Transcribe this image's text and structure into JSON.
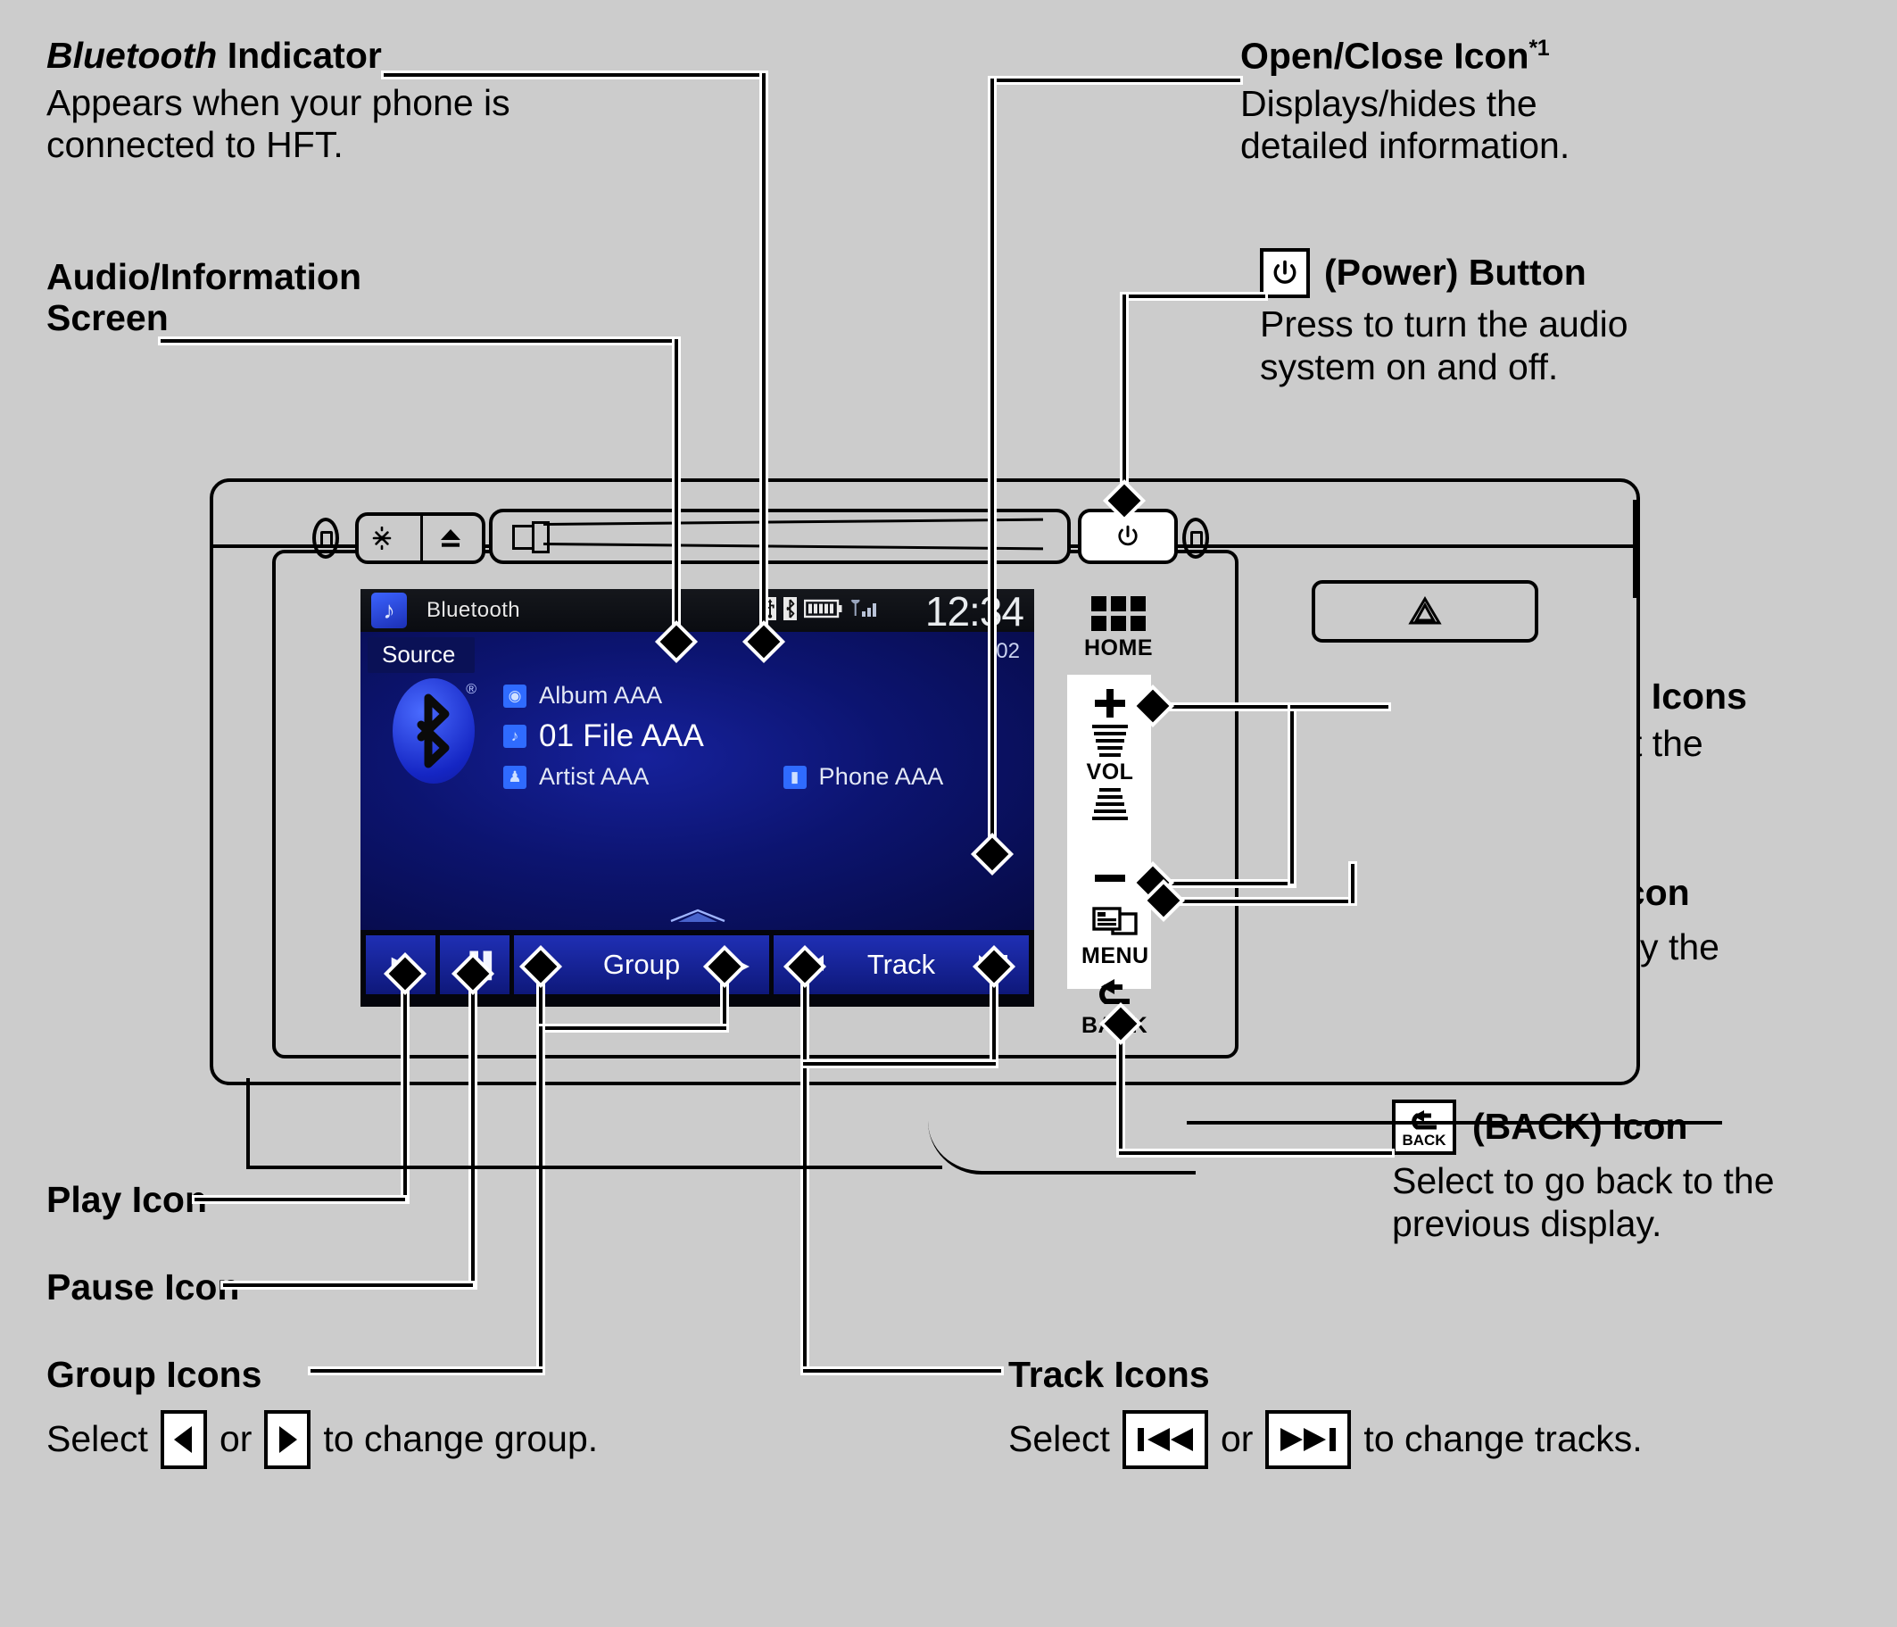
{
  "page": {
    "background_color": "#cccccc",
    "title": "Audio/Information Screen callout diagram"
  },
  "callouts": [
    {
      "id": "bluetooth-indicator",
      "title_italic": "Bluetooth",
      "title_rest": " Indicator",
      "body": "Appears when your phone is connected to HFT."
    },
    {
      "id": "audio-information-screen",
      "title": "Audio/Information Screen",
      "body": ""
    },
    {
      "id": "open-close-icon",
      "title": "Open/Close Icon",
      "superscript": "*1",
      "body": "Displays/hides the detailed information."
    },
    {
      "id": "power-button",
      "title": "(Power) Button",
      "icon": "power-icon",
      "body": "Press to turn the audio system on and off."
    },
    {
      "id": "volume-icons",
      "title": "VOL/ (Volume) Icons",
      "body": "Select to adjust the volume."
    },
    {
      "id": "menu-icon",
      "title": "(MENU) Icon",
      "icon": "menu-icon",
      "body": "Select to display the menu items."
    },
    {
      "id": "back-icon",
      "title": "(BACK) Icon",
      "icon": "back-icon",
      "body": "Select to go back to the previous display."
    },
    {
      "id": "play-icon",
      "title": "Play Icon",
      "body": ""
    },
    {
      "id": "pause-icon",
      "title": "Pause Icon",
      "body": ""
    },
    {
      "id": "group-icons",
      "title": "Group Icons",
      "prose_prefix": "Select",
      "prose_middle": "or",
      "prose_suffix": "to change group.",
      "icon_left": "triangle-left-icon",
      "icon_right": "triangle-right-icon"
    },
    {
      "id": "track-icons",
      "title": "Track Icons",
      "prose_prefix": "Select",
      "prose_middle": "or",
      "prose_suffix": "to change tracks.",
      "icon_left": "skip-previous-icon",
      "icon_right": "skip-next-icon"
    }
  ],
  "head_unit": {
    "top_buttons": {
      "display_mode_label": "display-mode-icon",
      "eject_label": "eject-icon"
    },
    "power_button_label": "power-icon",
    "hazard_button_label": "hazard-icon"
  },
  "display": {
    "status_bar": {
      "source_icon": "music-note-icon",
      "source_label": "Bluetooth",
      "icons": [
        "usb-icon",
        "bluetooth-icon",
        "battery-icon",
        "signal-icon"
      ],
      "clock": "12:34"
    },
    "content": {
      "source_tab": "Source",
      "logo": "bluetooth-logo",
      "track_number": "02",
      "rows": [
        {
          "icon": "album-icon",
          "text": "Album AAA",
          "emphasis": false
        },
        {
          "icon": "note-icon",
          "text": "01 File AAA",
          "emphasis": true
        },
        {
          "icon": "artist-icon",
          "text": "Artist AAA",
          "emphasis": false
        }
      ],
      "phone": {
        "icon": "phone-icon",
        "text": "Phone AAA"
      },
      "open_close_handle": "open-close-icon"
    },
    "buttons": [
      {
        "name": "play-button",
        "glyph": "▶",
        "label": ""
      },
      {
        "name": "pause-button",
        "glyph": "▐▐",
        "label": ""
      },
      {
        "name": "group-prev-button",
        "glyph": "◀",
        "label": ""
      },
      {
        "name": "group-label",
        "glyph": "",
        "label": "Group"
      },
      {
        "name": "group-next-button",
        "glyph": "▶",
        "label": ""
      },
      {
        "name": "track-prev-button",
        "glyph": "⏮",
        "label": ""
      },
      {
        "name": "track-label",
        "glyph": "",
        "label": "Track"
      },
      {
        "name": "track-next-button",
        "glyph": "⏭",
        "label": ""
      }
    ]
  },
  "hardware_keys": {
    "home": "HOME",
    "vol": "VOL",
    "vol_plus": "+",
    "vol_minus": "−",
    "menu": "MENU",
    "back": "BACK"
  }
}
